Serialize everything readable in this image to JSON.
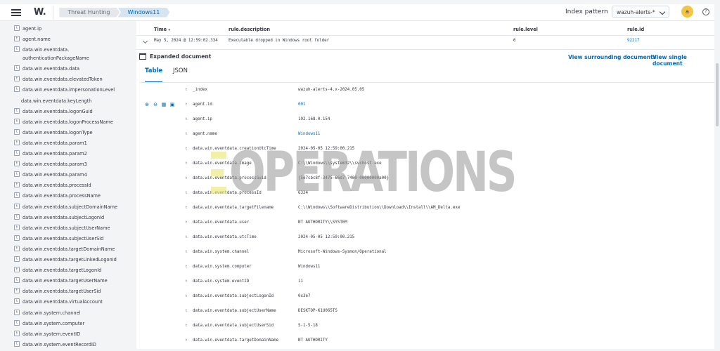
{
  "header": {
    "logo": "W.",
    "breadcrumbs": [
      "Threat Hunting",
      "Windows11"
    ],
    "index_pattern_label": "Index pattern",
    "index_pattern_value": "wazuh-alerts-*",
    "avatar": "a",
    "help": "?"
  },
  "sidebar": {
    "fields": [
      {
        "type": "t",
        "name": "agent.ip"
      },
      {
        "type": "t",
        "name": "agent.name"
      },
      {
        "type": "t",
        "name": "data.win.eventdata.\nauthenticationPackageName"
      },
      {
        "type": "t",
        "name": "data.win.eventdata.data"
      },
      {
        "type": "t",
        "name": "data.win.eventdata.elevatedToken"
      },
      {
        "type": "t",
        "name": "data.win.eventdata.impersonationLevel"
      },
      {
        "type": "",
        "name": "data.win.eventdata.keyLength"
      },
      {
        "type": "t",
        "name": "data.win.eventdata.logonGuid"
      },
      {
        "type": "t",
        "name": "data.win.eventdata.logonProcessName"
      },
      {
        "type": "t",
        "name": "data.win.eventdata.logonType"
      },
      {
        "type": "t",
        "name": "data.win.eventdata.param1"
      },
      {
        "type": "t",
        "name": "data.win.eventdata.param2"
      },
      {
        "type": "t",
        "name": "data.win.eventdata.param3"
      },
      {
        "type": "t",
        "name": "data.win.eventdata.param4"
      },
      {
        "type": "t",
        "name": "data.win.eventdata.processId"
      },
      {
        "type": "t",
        "name": "data.win.eventdata.processName"
      },
      {
        "type": "t",
        "name": "data.win.eventdata.subjectDomainName"
      },
      {
        "type": "t",
        "name": "data.win.eventdata.subjectLogonId"
      },
      {
        "type": "t",
        "name": "data.win.eventdata.subjectUserName"
      },
      {
        "type": "t",
        "name": "data.win.eventdata.subjectUserSid"
      },
      {
        "type": "t",
        "name": "data.win.eventdata.targetDomainName"
      },
      {
        "type": "t",
        "name": "data.win.eventdata.targetLinkedLogonId"
      },
      {
        "type": "t",
        "name": "data.win.eventdata.targetLogonId"
      },
      {
        "type": "t",
        "name": "data.win.eventdata.targetUserName"
      },
      {
        "type": "t",
        "name": "data.win.eventdata.targetUserSid"
      },
      {
        "type": "t",
        "name": "data.win.eventdata.virtualAccount"
      },
      {
        "type": "t",
        "name": "data.win.system.channel"
      },
      {
        "type": "t",
        "name": "data.win.system.computer"
      },
      {
        "type": "t",
        "name": "data.win.system.eventID"
      },
      {
        "type": "t",
        "name": "data.win.system.eventRecordID"
      }
    ]
  },
  "table": {
    "columns": {
      "time": "Time",
      "description": "rule.description",
      "level": "rule.level",
      "id": "rule.id"
    },
    "row": {
      "time": "May 5, 2024 @ 12:59:02.334",
      "description": "Executable dropped in Windows root folder",
      "level": "6",
      "id": "92217"
    }
  },
  "doc": {
    "expanded_label": "Expanded document",
    "view_surrounding": "View surrounding documents",
    "view_single": "View single document",
    "tabs": [
      "Table",
      "JSON"
    ],
    "fields": [
      {
        "t": "t",
        "k": "_index",
        "v": "wazuh-alerts-4.x-2024.05.05",
        "link": false
      },
      {
        "t": "t",
        "k": "agent.id",
        "v": "001",
        "link": true
      },
      {
        "t": "t",
        "k": "agent.ip",
        "v": "192.168.0.154",
        "link": false
      },
      {
        "t": "t",
        "k": "agent.name",
        "v": "Windows11",
        "link": true
      },
      {
        "t": "t",
        "k": "data.win.eventdata.creationUtcTime",
        "v": "2024-05-05 12:59:00.215",
        "link": false
      },
      {
        "t": "t",
        "k": "data.win.eventdata.image",
        "v": "C:\\\\Windows\\\\system32\\\\svchost.exe",
        "link": false
      },
      {
        "t": "t",
        "k": "data.win.eventdata.processGuid",
        "v": "{5e7cbc8f-3475-66d7-7400-00000000a00}",
        "link": false
      },
      {
        "t": "t",
        "k": "data.win.eventdata.processId",
        "v": "6324",
        "link": false
      },
      {
        "t": "t",
        "k": "data.win.eventdata.targetFilename",
        "v": "C:\\\\Windows\\\\SoftwareDistribution\\\\Download\\\\Install\\\\AM_Delta.exe",
        "link": false
      },
      {
        "t": "t",
        "k": "data.win.eventdata.user",
        "v": "NT AUTHORITY\\\\SYSTEM",
        "link": false
      },
      {
        "t": "t",
        "k": "data.win.eventdata.utcTime",
        "v": "2024-05-05 12:59:00.215",
        "link": false
      },
      {
        "t": "t",
        "k": "data.win.system.channel",
        "v": "Microsoft-Windows-Sysmon/Operational",
        "link": false
      },
      {
        "t": "t",
        "k": "data.win.system.computer",
        "v": "Windows11",
        "link": false
      },
      {
        "t": "t",
        "k": "data.win.system.eventID",
        "v": "11",
        "link": false
      },
      {
        "t": "t",
        "k": "data.win.eventdata.subjectLogonId",
        "v": "0x3e7",
        "link": false
      },
      {
        "t": "t",
        "k": "data.win.eventdata.subjectUserName",
        "v": "DESKTOP-K1U065TS",
        "link": false
      },
      {
        "t": "t",
        "k": "data.win.eventdata.subjectUserSid",
        "v": "S-1-5-18",
        "link": false
      },
      {
        "t": "t",
        "k": "data.win.eventdata.targetDomainName",
        "v": "NT AUTHORITY",
        "link": false
      }
    ]
  },
  "watermark": "OPERATIONS",
  "colors": {
    "link": "#006bb8",
    "avatar": "#f5c542",
    "watermark_accent": "#e8e66a"
  }
}
